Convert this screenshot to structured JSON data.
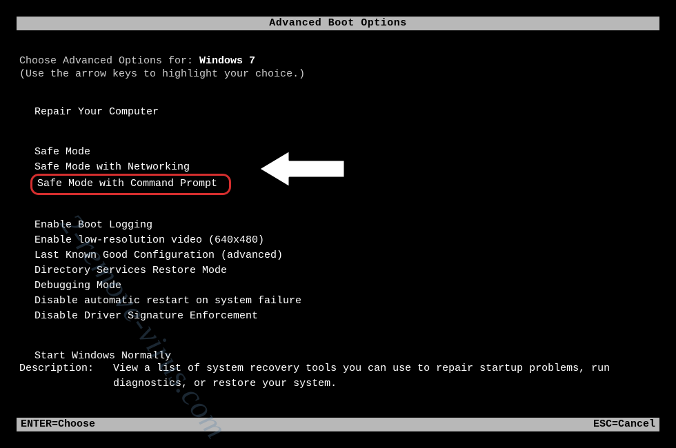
{
  "title": "Advanced Boot Options",
  "prompt_prefix": "Choose Advanced Options for: ",
  "os_name": "Windows 7",
  "hint": "(Use the arrow keys to highlight your choice.)",
  "groups": {
    "repair": [
      "Repair Your Computer"
    ],
    "safe": [
      "Safe Mode",
      "Safe Mode with Networking",
      "Safe Mode with Command Prompt"
    ],
    "advanced": [
      "Enable Boot Logging",
      "Enable low-resolution video (640x480)",
      "Last Known Good Configuration (advanced)",
      "Directory Services Restore Mode",
      "Debugging Mode",
      "Disable automatic restart on system failure",
      "Disable Driver Signature Enforcement"
    ],
    "normal": [
      "Start Windows Normally"
    ]
  },
  "selected_option": "Safe Mode with Command Prompt",
  "description_label": "Description:",
  "description_text": "View a list of system recovery tools you can use to repair startup problems, run diagnostics, or restore your system.",
  "footer": {
    "enter": "ENTER=Choose",
    "esc": "ESC=Cancel"
  },
  "watermark": "2-remove-virus.com"
}
